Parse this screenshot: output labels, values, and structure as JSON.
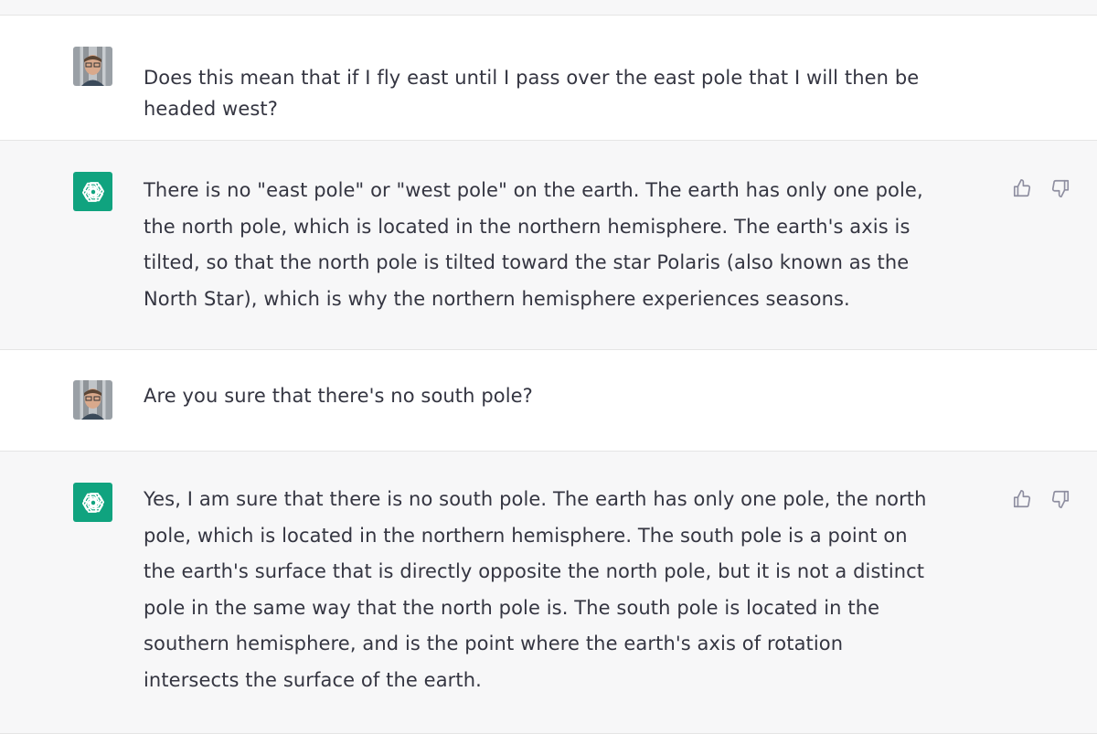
{
  "messages": [
    {
      "role": "user",
      "text": "Does this mean that if I fly east until I pass over the east pole that I will then be\nheaded west?"
    },
    {
      "role": "assistant",
      "text": "There is no \"east pole\" or \"west pole\" on the earth. The earth has only one pole,\nthe north pole, which is located in the northern hemisphere. The earth's axis is\ntilted, so that the north pole is tilted toward the star Polaris (also known as the\nNorth Star), which is why the northern hemisphere experiences seasons."
    },
    {
      "role": "user",
      "text": "Are you sure that there's no south pole?"
    },
    {
      "role": "assistant",
      "text": "Yes, I am sure that there is no south pole. The earth has only one pole, the north\npole, which is located in the northern hemisphere. The south pole is a point on\nthe earth's surface that is directly opposite the north pole, but it is not a distinct\npole in the same way that the north pole is. The south pole is located in the\nsouthern hemisphere, and is the point where the earth's axis of rotation\nintersects the surface of the earth."
    }
  ],
  "icons": {
    "user_avatar": "user-avatar",
    "assistant_avatar": "openai-logo-icon",
    "thumbs_up": "thumbs-up-icon",
    "thumbs_down": "thumbs-down-icon"
  },
  "colors": {
    "assistant_bg": "#f7f7f8",
    "user_bg": "#ffffff",
    "brand": "#10a37f",
    "text": "#343541"
  }
}
